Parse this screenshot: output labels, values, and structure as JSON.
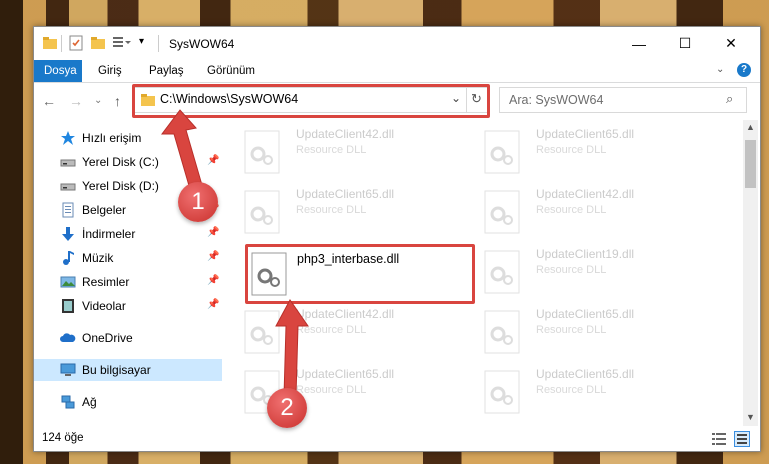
{
  "window": {
    "title": "SysWOW64",
    "minimize": "—",
    "maximize": "☐",
    "close": "✕"
  },
  "ribbon": {
    "tabs": [
      "Dosya",
      "Giriş",
      "Paylaş",
      "Görünüm"
    ],
    "active_tab": "Dosya"
  },
  "nav": {
    "address": "C:\\Windows\\SysWOW64",
    "search_placeholder": "Ara: SysWOW64"
  },
  "sidebar": {
    "items": [
      {
        "label": "Hızlı erişim",
        "icon": "star-icon"
      },
      {
        "label": "Yerel Disk (C:)",
        "icon": "drive-icon"
      },
      {
        "label": "Yerel Disk (D:)",
        "icon": "drive-icon"
      },
      {
        "label": "Belgeler",
        "icon": "document-icon"
      },
      {
        "label": "İndirmeler",
        "icon": "download-icon"
      },
      {
        "label": "Müzik",
        "icon": "music-icon"
      },
      {
        "label": "Resimler",
        "icon": "pictures-icon"
      },
      {
        "label": "Videolar",
        "icon": "video-icon"
      },
      {
        "label": "OneDrive",
        "icon": "cloud-icon"
      },
      {
        "label": "Bu bilgisayar",
        "icon": "computer-icon"
      },
      {
        "label": "Ağ",
        "icon": "network-icon"
      }
    ]
  },
  "files": [
    {
      "name": "UpdateClient42.dll",
      "type": "Resource DLL"
    },
    {
      "name": "UpdateClient65.dll",
      "type": "Resource DLL"
    },
    {
      "name": "UpdateClient65.dll",
      "type": "Resource DLL"
    },
    {
      "name": "UpdateClient42.dll",
      "type": "Resource DLL"
    },
    {
      "name": "UpdateClient19.dll",
      "type": "Resource DLL"
    },
    {
      "name": "UpdateClient42.dll",
      "type": "Resource DLL"
    },
    {
      "name": "UpdateClient65.dll",
      "type": "Resource DLL"
    },
    {
      "name": "UpdateClient65.dll",
      "type": "Resource DLL"
    },
    {
      "name": "UpdateClient65.dll",
      "type": "Resource DLL"
    }
  ],
  "highlighted_file": {
    "name": "php3_interbase.dll"
  },
  "status": {
    "item_count": "124 öğe"
  },
  "annotations": {
    "step1": "1",
    "step2": "2"
  },
  "colors": {
    "accent": "#1979ca",
    "highlight": "#d9453f",
    "selected": "#cce8ff"
  }
}
